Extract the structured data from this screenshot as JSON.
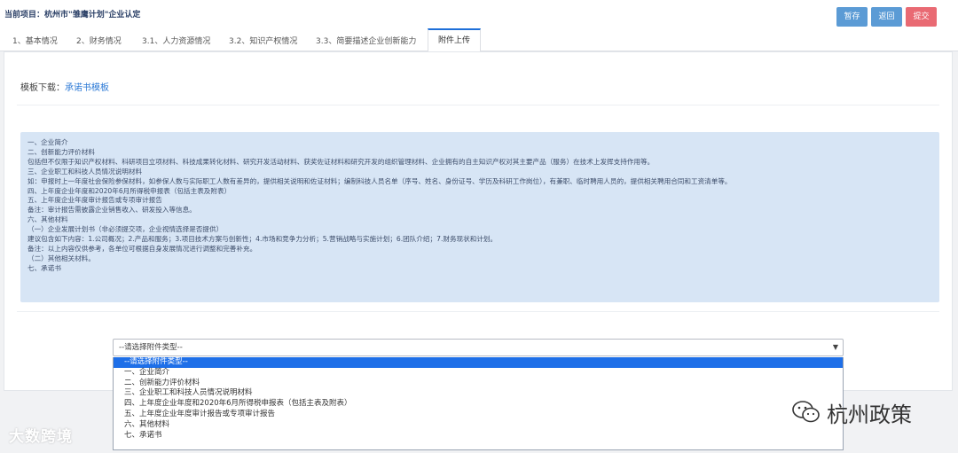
{
  "header": {
    "project": "当前项目：杭州市\"雏鹰计划\"企业认定",
    "buttons": {
      "save": "暂存",
      "back": "返回",
      "submit": "提交"
    }
  },
  "tabs": [
    "1、基本情况",
    "2、财务情况",
    "3.1、人力资源情况",
    "3.2、知识产权情况",
    "3.3、简要描述企业创新能力",
    "附件上传"
  ],
  "template": {
    "label": "模板下载：",
    "link": "承诺书模板"
  },
  "info_lines": [
    "一、企业简介",
    "二、创新能力评价材料",
    "包括但不仅限于知识产权材料、科研项目立项材料、科技成果转化材料、研究开发活动材料、获奖佐证材料和研究开发的组织管理材料、企业拥有的自主知识产权对其主要产品（服务）在技术上发挥支持作用等。",
    "三、企业职工和科技人员情况说明材料",
    "如：申报时上一年度社会保险参保材料，如参保人数与实际职工人数有差异的，提供相关说明和佐证材料；编制科技人员名单（序号、姓名、身份证号、学历及科研工作岗位），有兼职、临时聘用人员的，提供相关聘用合同和工资清单等。",
    "四、上年度企业年度和2020年6月所得税申报表（包括主表及附表）",
    "五、上年度企业年度审计报告或专项审计报告",
    "备注：审计报告需披露企业销售收入、研发投入等信息。",
    "六、其他材料",
    "（一）企业发展计划书（非必须提交项，企业视情选择是否提供）",
    "建议包含如下内容：1.公司概况；2.产品和服务；3.项目技术方案与创新性；4.市场和竞争力分析；5.营销战略与实施计划；6.团队介绍；7.财务现状和计划。",
    "备注：以上内容仅供参考，各单位可根据自身发展情况进行调整和完善补充。",
    "（二）其他相关材料。",
    "七、承诺书"
  ],
  "select": {
    "value": "--请选择附件类型--",
    "options": [
      "--请选择附件类型--",
      "一、企业简介",
      "二、创新能力评价材料",
      "三、企业职工和科技人员情况说明材料",
      "四、上年度企业年度和2020年6月所得税申报表（包括主表及附表）",
      "五、上年度企业年度审计报告或专项审计报告",
      "六、其他材料",
      "七、承诺书"
    ]
  },
  "watermarks": {
    "left": "大数跨境",
    "right": "杭州政策"
  },
  "icons": {
    "caret": "caret-down-icon",
    "wechat": "wechat-icon"
  },
  "colors": {
    "primary": "#5b9bd5",
    "danger": "#e96a73",
    "info_bg": "#d7e5f5",
    "selected": "#1e6fe8",
    "tab_accent": "#1e6fd9"
  }
}
